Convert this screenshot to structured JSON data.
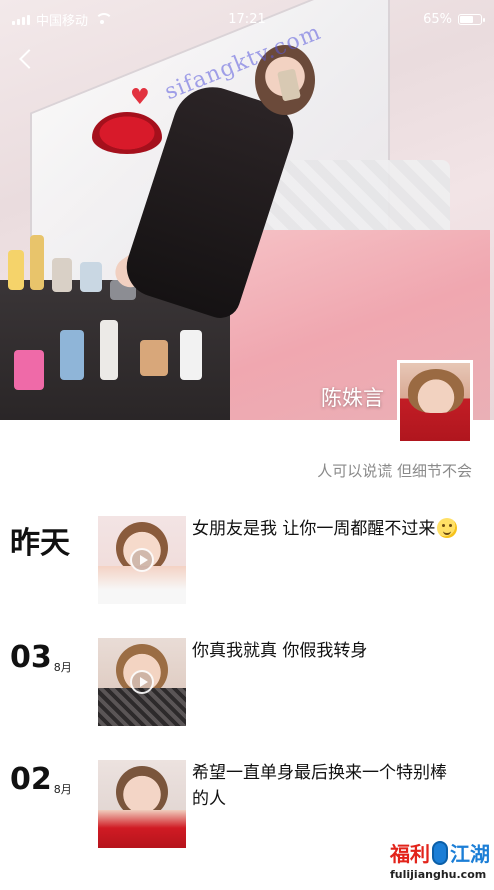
{
  "status_bar": {
    "carrier": "中国移动",
    "time": "17:21",
    "battery_percent": "65%",
    "battery_level": 0.65
  },
  "cover": {
    "watermark": "sifangktv.com"
  },
  "profile": {
    "name": "陈姝言",
    "signature": "人可以说谎 但细节不会"
  },
  "posts": [
    {
      "date_label": "昨天",
      "day": "",
      "month": "",
      "text": "女朋友是我 让你一周都醒不过来",
      "has_emoji": true,
      "is_video": true
    },
    {
      "date_label": "",
      "day": "03",
      "month": "8月",
      "text": "你真我就真 你假我转身",
      "has_emoji": false,
      "is_video": true
    },
    {
      "date_label": "",
      "day": "02",
      "month": "8月",
      "text": "希望一直单身最后换来一个特别棒的人",
      "has_emoji": false,
      "is_video": false
    }
  ],
  "site_logo": {
    "mark_part1": "福利",
    "mark_part2": "江湖",
    "domain": "fulijianghu.com"
  },
  "colors": {
    "accent_red": "#e2231a",
    "accent_blue": "#1b7ed6",
    "signature_gray": "#8a8a8a"
  },
  "icons": [
    "back-icon",
    "signal-icon",
    "wifi-icon",
    "battery-icon",
    "play-icon",
    "emoji-icon",
    "mouse-icon"
  ]
}
